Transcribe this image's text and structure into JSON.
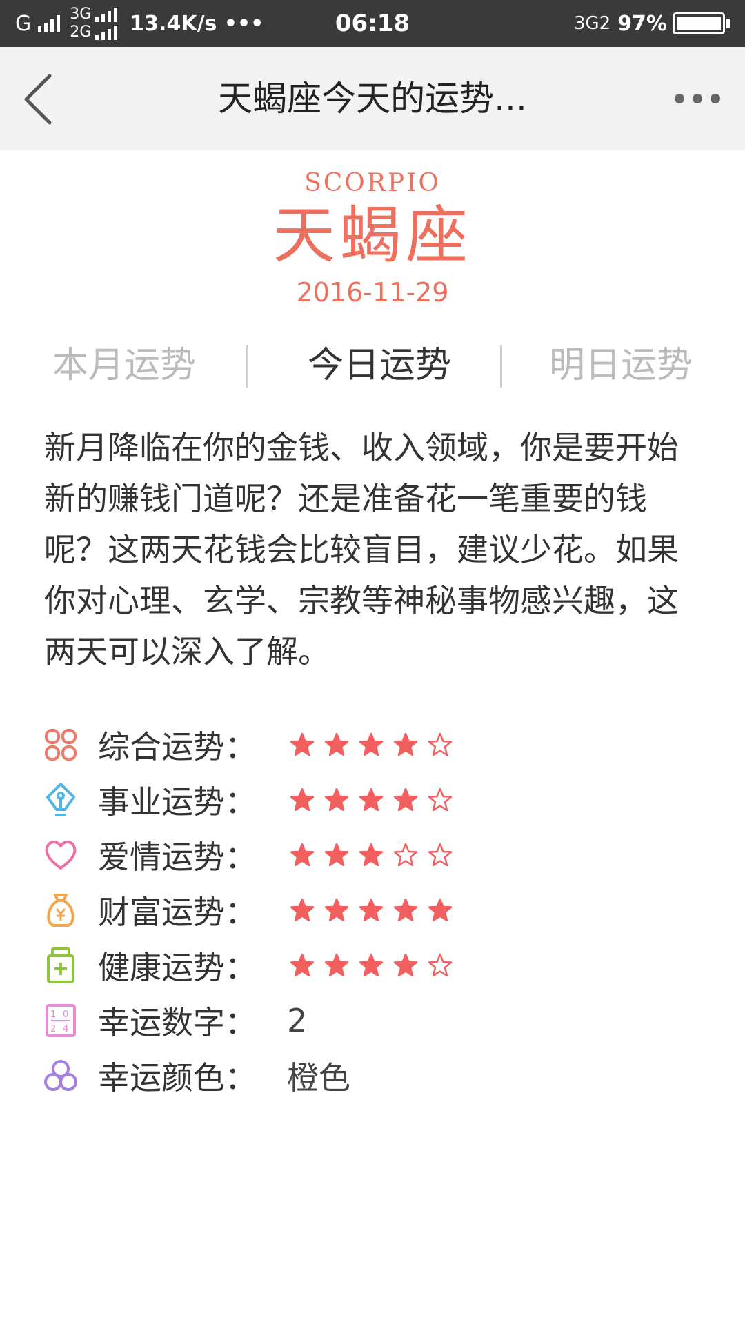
{
  "status_bar": {
    "carrier1": "G",
    "net_top": "3G",
    "net_bottom": "2G",
    "speed": "13.4K/s •••",
    "time": "06:18",
    "net_right": "3G2",
    "battery": "97%"
  },
  "appbar": {
    "title": "天蝎座今天的运势..."
  },
  "header": {
    "sign_en": "SCORPIO",
    "sign_cn": "天蝎座",
    "date": "2016-11-29"
  },
  "tabs": [
    {
      "label": "本月运势",
      "active": false
    },
    {
      "label": "今日运势",
      "active": true
    },
    {
      "label": "明日运势",
      "active": false
    }
  ],
  "description": "新月降临在你的金钱、收入领域，你是要开始新的赚钱门道呢？还是准备花一笔重要的钱呢？这两天花钱会比较盲目，建议少花。如果你对心理、玄学、宗教等神秘事物感兴趣，这两天可以深入了解。",
  "ratings": [
    {
      "label": "综合运势：",
      "stars": 4,
      "icon": "clover-icon",
      "color": "#f07a6a"
    },
    {
      "label": "事业运势：",
      "stars": 4,
      "icon": "pen-nib-icon",
      "color": "#4fb4e6"
    },
    {
      "label": "爱情运势：",
      "stars": 3,
      "icon": "heart-icon",
      "color": "#ee6fa6"
    },
    {
      "label": "财富运势：",
      "stars": 5,
      "icon": "money-bag-icon",
      "color": "#f2a54a"
    },
    {
      "label": "健康运势：",
      "stars": 4,
      "icon": "medicine-bottle-icon",
      "color": "#8cc43c"
    }
  ],
  "lucky": [
    {
      "label": "幸运数字：",
      "value": "2",
      "icon": "number-grid-icon",
      "color": "#e88ad8"
    },
    {
      "label": "幸运颜色：",
      "value": "橙色",
      "icon": "color-circles-icon",
      "color": "#a47fe0"
    }
  ],
  "star_color": "#f25f5f",
  "star_total": 5
}
